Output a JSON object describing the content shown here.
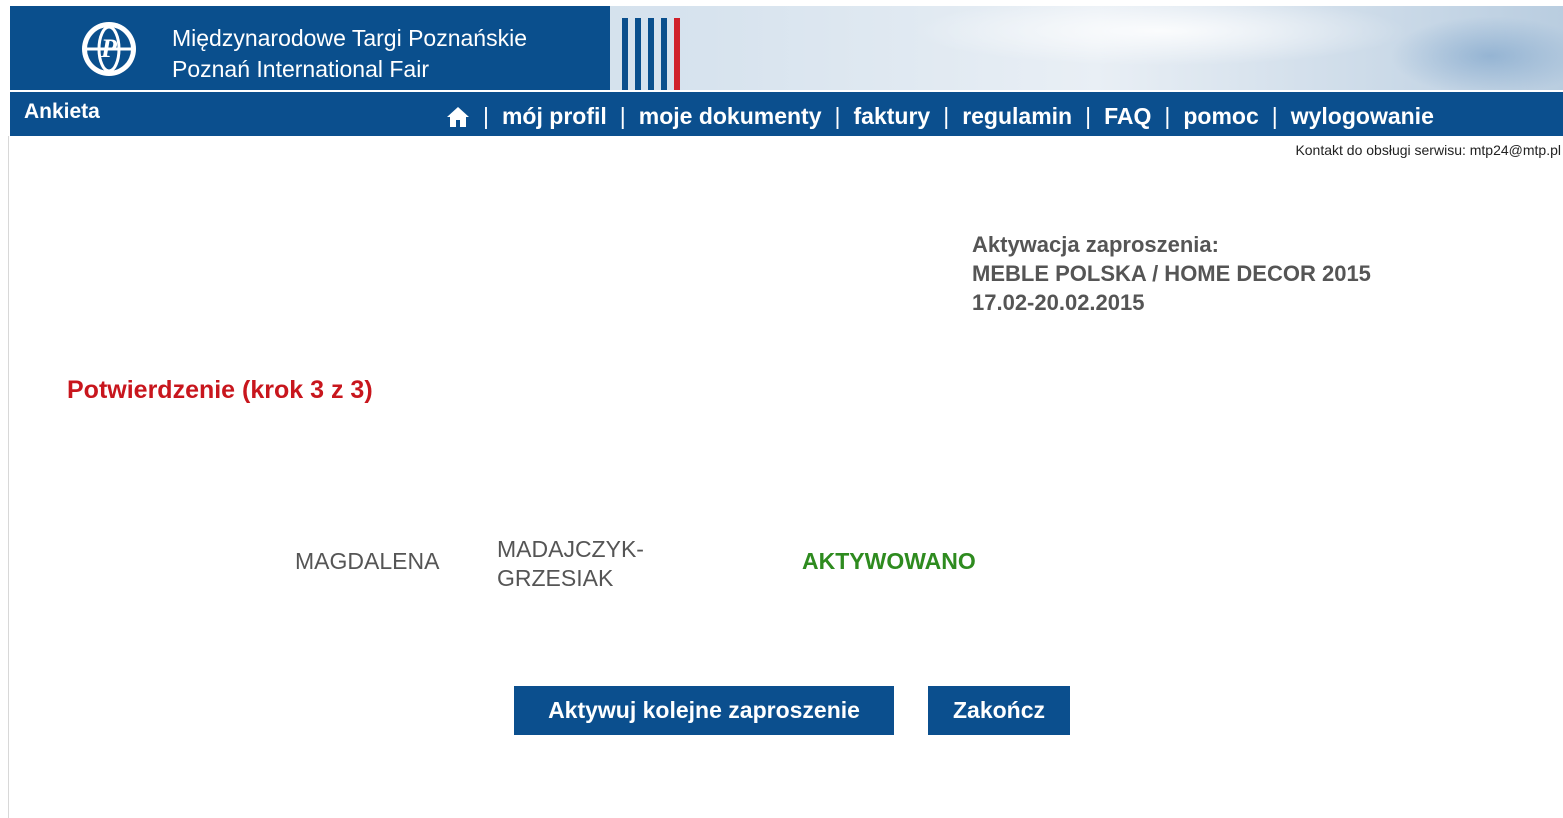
{
  "header": {
    "brand_pl": "Międzynarodowe Targi Poznańskie",
    "brand_en": "Poznań International Fair",
    "logo_icon": "mtp-globe-logo"
  },
  "nav": {
    "title": "Ankieta",
    "home_icon": "home-icon",
    "links": [
      "mój profil",
      "moje dokumenty",
      "faktury",
      "regulamin",
      "FAQ",
      "pomoc",
      "wylogowanie"
    ],
    "separator": "|"
  },
  "contact": "Kontakt do obsługi serwisu: mtp24@mtp.pl",
  "invitation": {
    "heading": "Aktywacja zaproszenia:",
    "event": "MEBLE POLSKA / HOME DECOR 2015",
    "dates": "17.02-20.02.2015"
  },
  "step": {
    "title": "Potwierdzenie (krok 3 z 3)"
  },
  "person": {
    "first_name": "MAGDALENA",
    "last_name": "MADAJCZYK-GRZESIAK",
    "status": "AKTYWOWANO"
  },
  "actions": {
    "next_label": "Aktywuj kolejne zaproszenie",
    "finish_label": "Zakończ"
  },
  "colors": {
    "brand_blue": "#0b4f8e",
    "step_red": "#c8161d",
    "status_green": "#2e8b1f",
    "text_gray": "#555555"
  }
}
